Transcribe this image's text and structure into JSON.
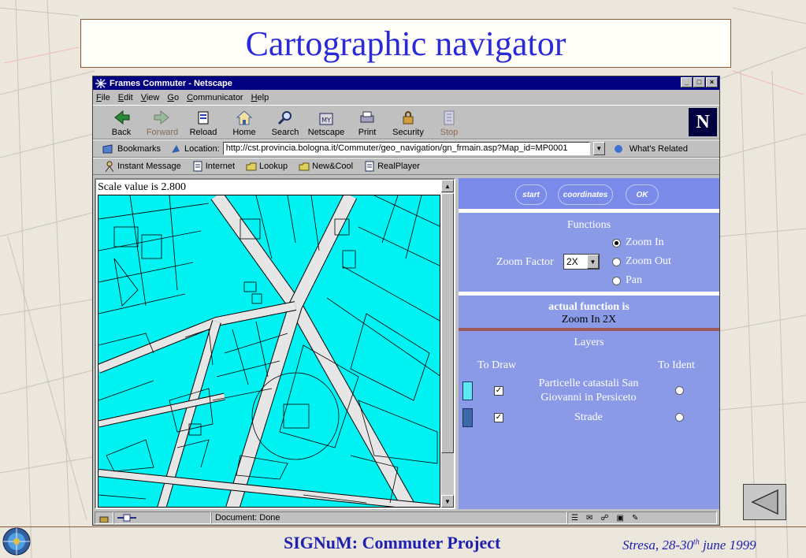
{
  "slide": {
    "title": "Cartographic navigator",
    "footer_title": "SIGNuM: Commuter Project",
    "footer_date_prefix": "Stresa, 28-30",
    "footer_date_sup": "th",
    "footer_date_suffix": " june 1999"
  },
  "window": {
    "title": "Frames Commuter - Netscape",
    "controls": [
      "_",
      "□",
      "×"
    ]
  },
  "menu": [
    "File",
    "Edit",
    "View",
    "Go",
    "Communicator",
    "Help"
  ],
  "toolbar": [
    {
      "label": "Back",
      "icon": "back-arrow-icon"
    },
    {
      "label": "Forward",
      "icon": "forward-arrow-icon",
      "disabled": true
    },
    {
      "label": "Reload",
      "icon": "reload-icon"
    },
    {
      "label": "Home",
      "icon": "home-icon"
    },
    {
      "label": "Search",
      "icon": "search-icon"
    },
    {
      "label": "Netscape",
      "icon": "netscape-icon"
    },
    {
      "label": "Print",
      "icon": "print-icon"
    },
    {
      "label": "Security",
      "icon": "lock-icon"
    },
    {
      "label": "Stop",
      "icon": "stop-icon",
      "disabled": true
    }
  ],
  "netscape_logo": "N",
  "location": {
    "bookmarks_label": "Bookmarks",
    "location_label": "Location:",
    "url": "http://cst.provincia.bologna.it/Commuter/geo_navigation/gn_frmain.asp?Map_id=MP0001",
    "whats_related": "What's Related"
  },
  "personal_bar": [
    "Instant Message",
    "Internet",
    "Lookup",
    "New&Cool",
    "RealPlayer"
  ],
  "map": {
    "scale_text": "Scale value is 2.800",
    "colors": {
      "parcel_fill": "#00f2f2",
      "road": "#e6e6e6",
      "line": "#000000"
    }
  },
  "controls": {
    "buttons": [
      "start",
      "coordinates",
      "OK"
    ]
  },
  "functions": {
    "header": "Functions",
    "zoom_factor_label": "Zoom Factor",
    "zoom_factor_value": "2X",
    "options": [
      {
        "label": "Zoom In",
        "selected": true
      },
      {
        "label": "Zoom Out",
        "selected": false
      },
      {
        "label": "Pan",
        "selected": false
      }
    ]
  },
  "actual_function": {
    "label": "actual function is",
    "value": "Zoom In 2X"
  },
  "layers": {
    "header": "Layers",
    "col_draw": "To Draw",
    "col_ident": "To Ident",
    "items": [
      {
        "name_line1": "Particelle catastali San",
        "name_line2": "Giovanni in Persiceto",
        "color": "#5ce8f0",
        "draw": true,
        "ident": false
      },
      {
        "name_line1": "Strade",
        "name_line2": "",
        "color": "#3a6aa8",
        "draw": true,
        "ident": false
      }
    ]
  },
  "status": {
    "text": "Document: Done"
  },
  "colors": {
    "title_blue": "#2a2ad8",
    "panel_blue": "#8a9ae6",
    "netscape_titlebar": "#000080"
  }
}
